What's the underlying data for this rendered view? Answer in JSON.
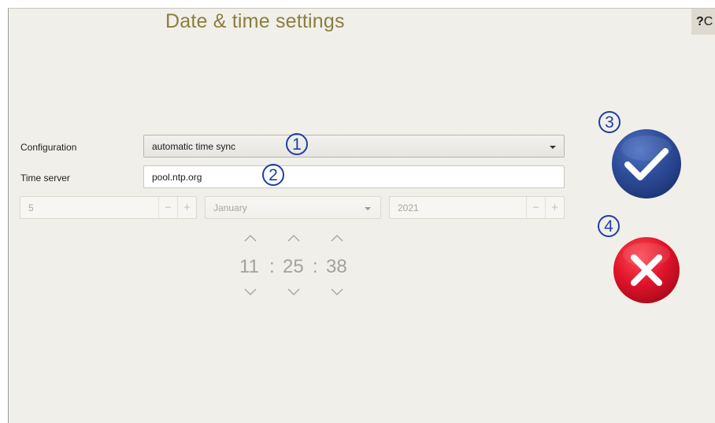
{
  "header": {
    "title": "Date & time settings",
    "help_label": "?",
    "help_extra": "C"
  },
  "form": {
    "configuration_label": "Configuration",
    "configuration_value": "automatic time sync",
    "time_server_label": "Time server",
    "time_server_value": "pool.ntp.org",
    "day_value": "5",
    "month_value": "January",
    "year_value": "2021",
    "minus_glyph": "−",
    "plus_glyph": "+"
  },
  "time": {
    "hours": "11",
    "minutes": "25",
    "seconds": "38",
    "separator": ":"
  },
  "annotations": [
    "1",
    "2",
    "3",
    "4"
  ],
  "colors": {
    "title": "#8a7e3e",
    "confirm": "#2f4f9e",
    "cancel": "#e0142a",
    "badge": "#1e3fa6"
  },
  "icons": {
    "confirm": "checkmark-icon",
    "cancel": "close-icon"
  }
}
